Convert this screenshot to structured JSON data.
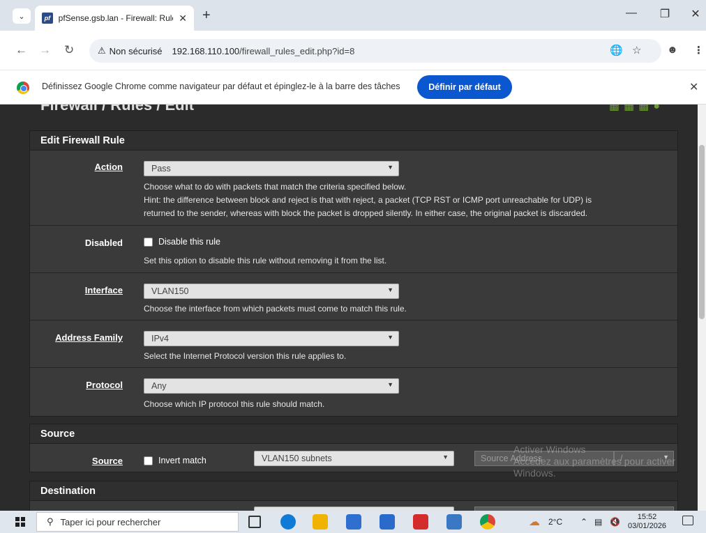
{
  "browser": {
    "tab_title": "pfSense.gsb.lan - Firewall: Rules",
    "tab_favicon": "pf",
    "new_tab": "+",
    "security_label": "Non sécurisé",
    "url_host": "192.168.110.100",
    "url_path": "/firewall_rules_edit.php?id=8"
  },
  "infobar": {
    "message": "Définissez Google Chrome comme navigateur par défaut et épinglez-le à la barre des tâches",
    "button": "Définir par défaut"
  },
  "page": {
    "breadcrumb_main": "Firewall / Rules / Edit",
    "edit_panel_title": "Edit Firewall Rule",
    "action": {
      "label": "Action",
      "value": "Pass",
      "help1": "Choose what to do with packets that match the criteria specified below.",
      "help2": "Hint: the difference between block and reject is that with reject, a packet (TCP RST or ICMP port unreachable for UDP) is",
      "help3": "returned to the sender, whereas with block the packet is dropped silently. In either case, the original packet is discarded."
    },
    "disabled": {
      "label": "Disabled",
      "checkbox_label": "Disable this rule",
      "help": "Set this option to disable this rule without removing it from the list."
    },
    "interface": {
      "label": "Interface",
      "value": "VLAN150",
      "help": "Choose the interface from which packets must come to match this rule."
    },
    "address_family": {
      "label": "Address Family",
      "value": "IPv4",
      "help": "Select the Internet Protocol version this rule applies to."
    },
    "protocol": {
      "label": "Protocol",
      "value": "Any",
      "help": "Choose which IP protocol this rule should match."
    },
    "source_panel_title": "Source",
    "source": {
      "label": "Source",
      "invert_label": "Invert match",
      "type_value": "VLAN150 subnets",
      "address_placeholder": "Source Address",
      "mask_separator": "/"
    },
    "destination_panel_title": "Destination",
    "watermark_line1": "Activer Windows",
    "watermark_line2": "Accédez aux paramètres pour activer",
    "watermark_line3": "Windows."
  },
  "taskbar": {
    "search_placeholder": "Taper ici pour rechercher",
    "weather": "2°C",
    "time": "15:52",
    "date": "03/01/2026"
  },
  "colors": {
    "accent_blue": "#0b57d0",
    "pfsense_green": "#6f9b3a",
    "page_bg": "#2b2b2b"
  }
}
